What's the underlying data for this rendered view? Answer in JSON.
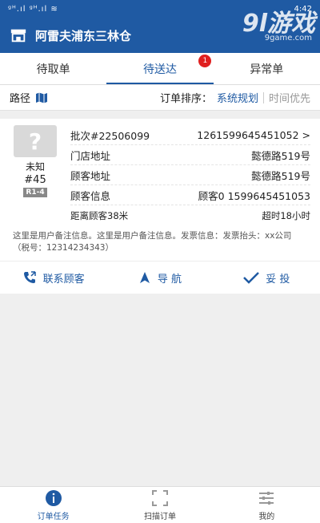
{
  "status_bar": {
    "signal": "ᵍᴴ.ıl ᵍᴴ.ıl ≋",
    "time": "4:42"
  },
  "watermark": {
    "logo": "9l游戏",
    "domain": "9game.com"
  },
  "header": {
    "title": "阿雷夫浦东三林仓"
  },
  "tabs": [
    {
      "label": "待取单"
    },
    {
      "label": "待送达",
      "badge": "1"
    },
    {
      "label": "异常单"
    }
  ],
  "filter": {
    "route_label": "路径",
    "sort_label": "订单排序：",
    "sort_options": [
      "系统规划",
      "时间优先"
    ]
  },
  "order": {
    "avatar_symbol": "?",
    "status": "未知",
    "number": "#45",
    "shelf": "R1-4",
    "batch": "批次#22506099",
    "order_id": "1261599645451052 >",
    "rows": [
      {
        "label": "门店地址",
        "value": "懿德路519号"
      },
      {
        "label": "顾客地址",
        "value": "懿德路519号"
      },
      {
        "label": "顾客信息",
        "value": "顾客0 1599645451053"
      }
    ],
    "distance": "距离顾客38米",
    "overtime": "超时18小时",
    "remark": "这里是用户备注信息。这里是用户备注信息。发票信息：发票抬头：xx公司（税号：12314234343）"
  },
  "actions": {
    "contact": "联系顾客",
    "navigate": "导 航",
    "deliver": "妥 投"
  },
  "bottom_nav": [
    {
      "label": "订单任务",
      "icon": "info-icon"
    },
    {
      "label": "扫描订单",
      "icon": "scan-icon"
    },
    {
      "label": "我的",
      "icon": "sliders-icon"
    }
  ],
  "colors": {
    "primary": "#1f5aa3",
    "badge": "#e02020"
  }
}
